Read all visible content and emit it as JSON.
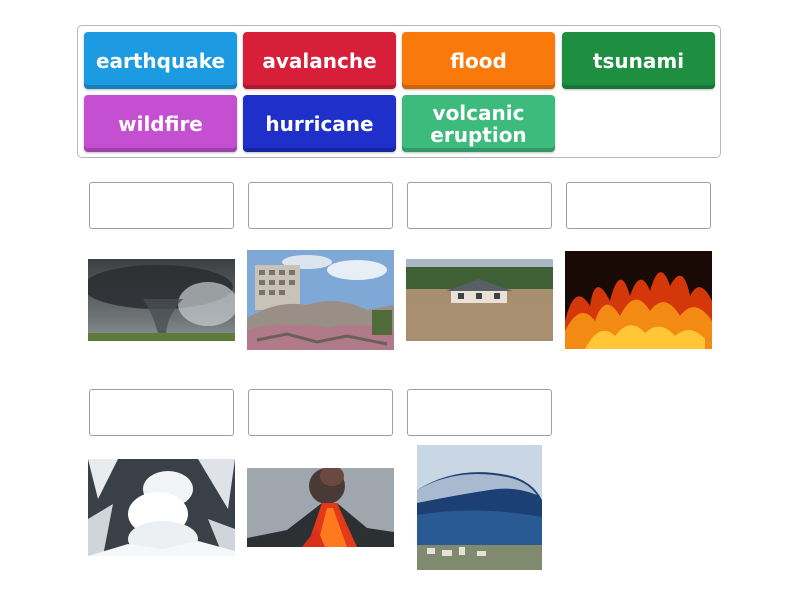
{
  "word_bank": {
    "tiles": [
      {
        "label": "earthquake",
        "color": "#1c9be2"
      },
      {
        "label": "avalanche",
        "color": "#d81f3a"
      },
      {
        "label": "flood",
        "color": "#f97a0a"
      },
      {
        "label": "tsunami",
        "color": "#1e8f41"
      },
      {
        "label": "wildfire",
        "color": "#c44fd0"
      },
      {
        "label": "hurricane",
        "color": "#1f2fc9"
      },
      {
        "label": "volcanic eruption",
        "color": "#3dbb7d"
      }
    ]
  },
  "pictures": [
    {
      "icon": "tornado-photo"
    },
    {
      "icon": "earthquake-rubble-photo"
    },
    {
      "icon": "flooded-house-photo"
    },
    {
      "icon": "wildfire-photo"
    },
    {
      "icon": "avalanche-photo"
    },
    {
      "icon": "volcano-eruption-photo"
    },
    {
      "icon": "tsunami-wave-photo"
    }
  ]
}
